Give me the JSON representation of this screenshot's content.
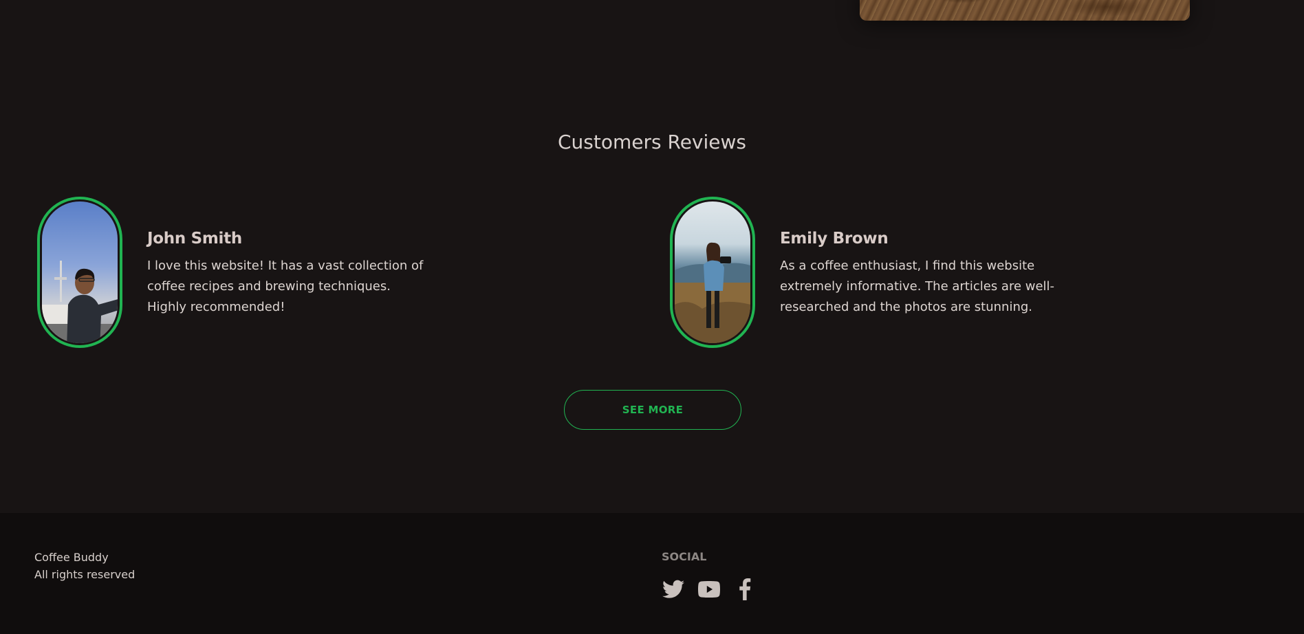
{
  "reviews_section": {
    "title": "Customers Reviews",
    "reviews": [
      {
        "name": "John Smith",
        "text": "I love this website! It has a vast collection of coffee recipes and brewing techniques. Highly recommended!"
      },
      {
        "name": "Emily Brown",
        "text": "As a coffee enthusiast, I find this website extremely informative. The articles are well-researched and the photos are stunning."
      }
    ],
    "see_more_label": "SEE MORE"
  },
  "footer": {
    "brand": "Coffee Buddy",
    "rights": "All rights reserved",
    "social_title": "SOCIAL",
    "social_icons": [
      "twitter-icon",
      "youtube-icon",
      "facebook-icon"
    ]
  },
  "colors": {
    "accent": "#21b452",
    "background": "#181414",
    "footer_background": "#100d0d"
  }
}
